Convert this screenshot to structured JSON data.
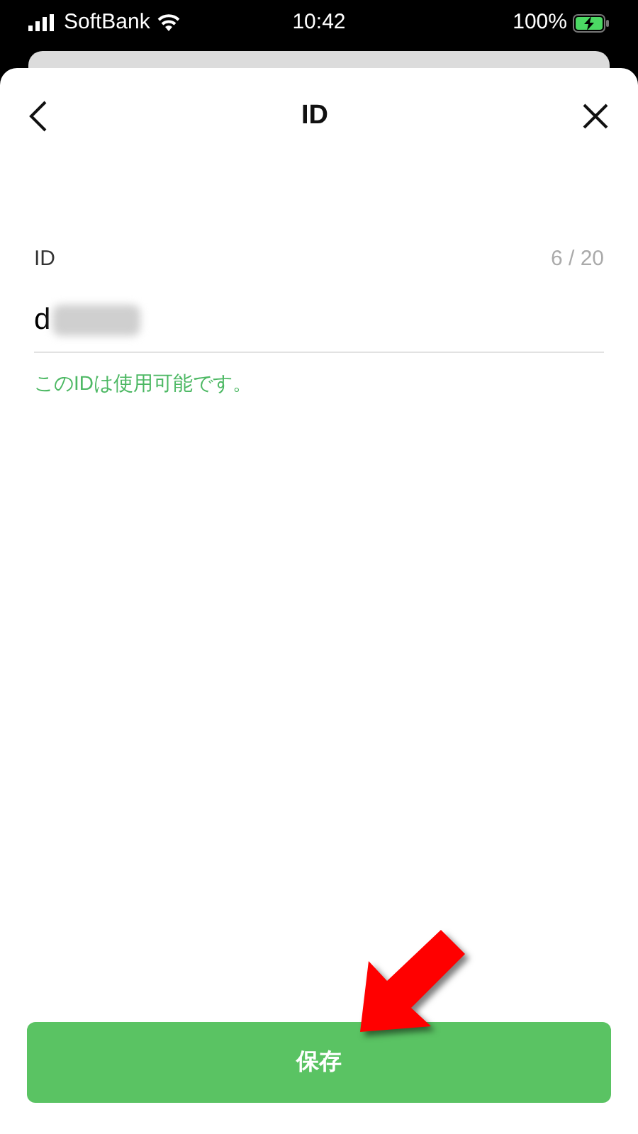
{
  "status_bar": {
    "carrier": "SoftBank",
    "time": "10:42",
    "battery": "100%"
  },
  "header": {
    "title": "ID"
  },
  "field": {
    "label": "ID",
    "counter": "6 / 20",
    "value": "d",
    "redacted": true
  },
  "message": "このIDは使用可能です。",
  "save_button": "保存"
}
